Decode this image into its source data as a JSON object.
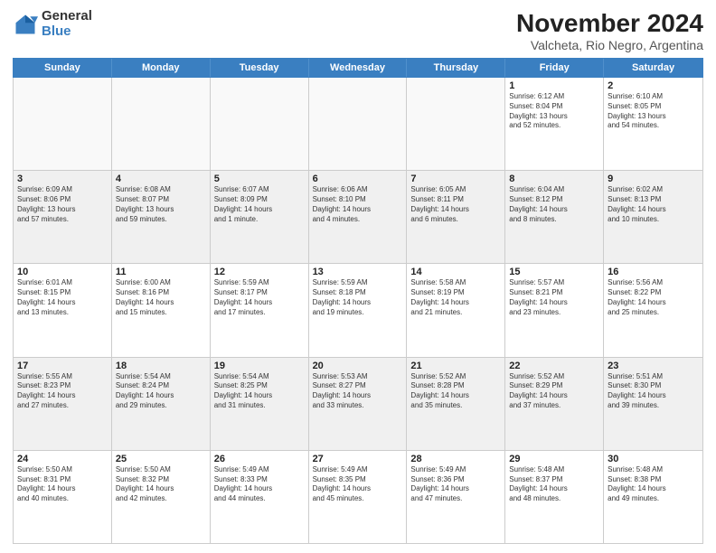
{
  "logo": {
    "general": "General",
    "blue": "Blue"
  },
  "title": "November 2024",
  "subtitle": "Valcheta, Rio Negro, Argentina",
  "headers": [
    "Sunday",
    "Monday",
    "Tuesday",
    "Wednesday",
    "Thursday",
    "Friday",
    "Saturday"
  ],
  "weeks": [
    [
      {
        "day": "",
        "info": ""
      },
      {
        "day": "",
        "info": ""
      },
      {
        "day": "",
        "info": ""
      },
      {
        "day": "",
        "info": ""
      },
      {
        "day": "",
        "info": ""
      },
      {
        "day": "1",
        "info": "Sunrise: 6:12 AM\nSunset: 8:04 PM\nDaylight: 13 hours\nand 52 minutes."
      },
      {
        "day": "2",
        "info": "Sunrise: 6:10 AM\nSunset: 8:05 PM\nDaylight: 13 hours\nand 54 minutes."
      }
    ],
    [
      {
        "day": "3",
        "info": "Sunrise: 6:09 AM\nSunset: 8:06 PM\nDaylight: 13 hours\nand 57 minutes."
      },
      {
        "day": "4",
        "info": "Sunrise: 6:08 AM\nSunset: 8:07 PM\nDaylight: 13 hours\nand 59 minutes."
      },
      {
        "day": "5",
        "info": "Sunrise: 6:07 AM\nSunset: 8:09 PM\nDaylight: 14 hours\nand 1 minute."
      },
      {
        "day": "6",
        "info": "Sunrise: 6:06 AM\nSunset: 8:10 PM\nDaylight: 14 hours\nand 4 minutes."
      },
      {
        "day": "7",
        "info": "Sunrise: 6:05 AM\nSunset: 8:11 PM\nDaylight: 14 hours\nand 6 minutes."
      },
      {
        "day": "8",
        "info": "Sunrise: 6:04 AM\nSunset: 8:12 PM\nDaylight: 14 hours\nand 8 minutes."
      },
      {
        "day": "9",
        "info": "Sunrise: 6:02 AM\nSunset: 8:13 PM\nDaylight: 14 hours\nand 10 minutes."
      }
    ],
    [
      {
        "day": "10",
        "info": "Sunrise: 6:01 AM\nSunset: 8:15 PM\nDaylight: 14 hours\nand 13 minutes."
      },
      {
        "day": "11",
        "info": "Sunrise: 6:00 AM\nSunset: 8:16 PM\nDaylight: 14 hours\nand 15 minutes."
      },
      {
        "day": "12",
        "info": "Sunrise: 5:59 AM\nSunset: 8:17 PM\nDaylight: 14 hours\nand 17 minutes."
      },
      {
        "day": "13",
        "info": "Sunrise: 5:59 AM\nSunset: 8:18 PM\nDaylight: 14 hours\nand 19 minutes."
      },
      {
        "day": "14",
        "info": "Sunrise: 5:58 AM\nSunset: 8:19 PM\nDaylight: 14 hours\nand 21 minutes."
      },
      {
        "day": "15",
        "info": "Sunrise: 5:57 AM\nSunset: 8:21 PM\nDaylight: 14 hours\nand 23 minutes."
      },
      {
        "day": "16",
        "info": "Sunrise: 5:56 AM\nSunset: 8:22 PM\nDaylight: 14 hours\nand 25 minutes."
      }
    ],
    [
      {
        "day": "17",
        "info": "Sunrise: 5:55 AM\nSunset: 8:23 PM\nDaylight: 14 hours\nand 27 minutes."
      },
      {
        "day": "18",
        "info": "Sunrise: 5:54 AM\nSunset: 8:24 PM\nDaylight: 14 hours\nand 29 minutes."
      },
      {
        "day": "19",
        "info": "Sunrise: 5:54 AM\nSunset: 8:25 PM\nDaylight: 14 hours\nand 31 minutes."
      },
      {
        "day": "20",
        "info": "Sunrise: 5:53 AM\nSunset: 8:27 PM\nDaylight: 14 hours\nand 33 minutes."
      },
      {
        "day": "21",
        "info": "Sunrise: 5:52 AM\nSunset: 8:28 PM\nDaylight: 14 hours\nand 35 minutes."
      },
      {
        "day": "22",
        "info": "Sunrise: 5:52 AM\nSunset: 8:29 PM\nDaylight: 14 hours\nand 37 minutes."
      },
      {
        "day": "23",
        "info": "Sunrise: 5:51 AM\nSunset: 8:30 PM\nDaylight: 14 hours\nand 39 minutes."
      }
    ],
    [
      {
        "day": "24",
        "info": "Sunrise: 5:50 AM\nSunset: 8:31 PM\nDaylight: 14 hours\nand 40 minutes."
      },
      {
        "day": "25",
        "info": "Sunrise: 5:50 AM\nSunset: 8:32 PM\nDaylight: 14 hours\nand 42 minutes."
      },
      {
        "day": "26",
        "info": "Sunrise: 5:49 AM\nSunset: 8:33 PM\nDaylight: 14 hours\nand 44 minutes."
      },
      {
        "day": "27",
        "info": "Sunrise: 5:49 AM\nSunset: 8:35 PM\nDaylight: 14 hours\nand 45 minutes."
      },
      {
        "day": "28",
        "info": "Sunrise: 5:49 AM\nSunset: 8:36 PM\nDaylight: 14 hours\nand 47 minutes."
      },
      {
        "day": "29",
        "info": "Sunrise: 5:48 AM\nSunset: 8:37 PM\nDaylight: 14 hours\nand 48 minutes."
      },
      {
        "day": "30",
        "info": "Sunrise: 5:48 AM\nSunset: 8:38 PM\nDaylight: 14 hours\nand 49 minutes."
      }
    ]
  ]
}
